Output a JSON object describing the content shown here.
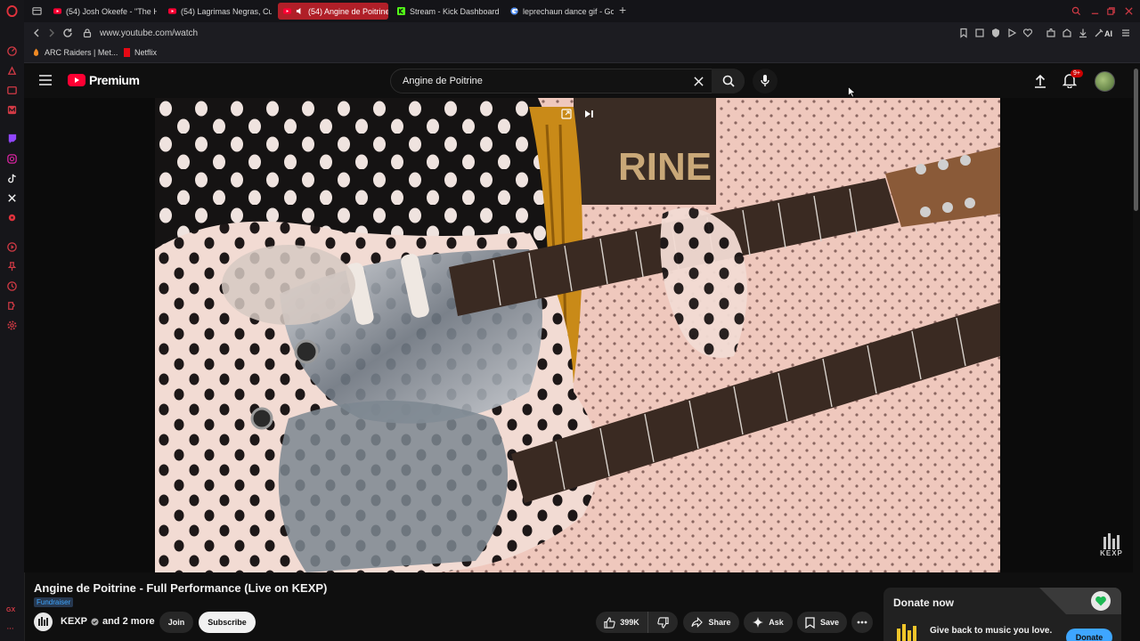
{
  "tabs": [
    {
      "label": "(54) Josh Okeefe - \"The H",
      "active": false,
      "favicon": "youtube-icon"
    },
    {
      "label": "(54) Lagrimas Negras, Cu",
      "active": false,
      "favicon": "youtube-icon"
    },
    {
      "label": "(54) Angine de Poitrine",
      "active": true,
      "favicon": "youtube-icon"
    },
    {
      "label": "Stream - Kick Dashboard",
      "active": false,
      "favicon": "kick-icon"
    },
    {
      "label": "leprechaun dance gif - Go",
      "active": false,
      "favicon": "google-icon"
    }
  ],
  "address": {
    "url": "www.youtube.com/watch"
  },
  "toolbar_right": {
    "ai_label": "AI"
  },
  "bookmarks": [
    {
      "label": "ARC Raiders | Met..."
    },
    {
      "label": "Netflix"
    }
  ],
  "sidebar": {
    "bottom_label": "GX"
  },
  "youtube": {
    "logo_text": "Premium",
    "search_value": "Angine de Poitrine",
    "notification_count": "9+"
  },
  "video": {
    "poster_letters": "RINE",
    "watermark": "KEXP"
  },
  "meta": {
    "title": "Angine de Poitrine - Full Performance (Live on KEXP)",
    "badge": "Fundraiser",
    "channel": "KEXP",
    "channel_suffix": "and 2 more",
    "join_label": "Join",
    "subscribe_label": "Subscribe",
    "likes": "399K",
    "share_label": "Share",
    "ask_label": "Ask",
    "save_label": "Save"
  },
  "donate": {
    "header": "Donate now",
    "text": "Give back to music you love.",
    "button_label": "Donate"
  },
  "colors": {
    "accent_red": "#ff0033",
    "active_tab": "#b01f28",
    "subscribe_bg": "#f1f1f1"
  }
}
